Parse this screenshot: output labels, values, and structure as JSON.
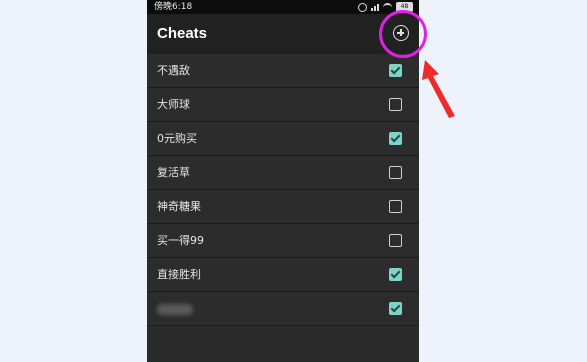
{
  "status_bar": {
    "time": "傍晚6:18",
    "battery": "48"
  },
  "app_bar": {
    "title": "Cheats",
    "add_icon": "plus-circle-icon"
  },
  "cheats": [
    {
      "label": "不遇敌",
      "checked": true
    },
    {
      "label": "大师球",
      "checked": false
    },
    {
      "label": "0元购买",
      "checked": true
    },
    {
      "label": "复活草",
      "checked": false
    },
    {
      "label": "神奇糖果",
      "checked": false
    },
    {
      "label": "买一得99",
      "checked": false
    },
    {
      "label": "直接胜利",
      "checked": true
    },
    {
      "label": "",
      "checked": true,
      "blurred": true
    }
  ],
  "colors": {
    "checkbox_checked": "#7fd3c8",
    "highlight": "#e020e6",
    "arrow": "#ee2a2a"
  }
}
